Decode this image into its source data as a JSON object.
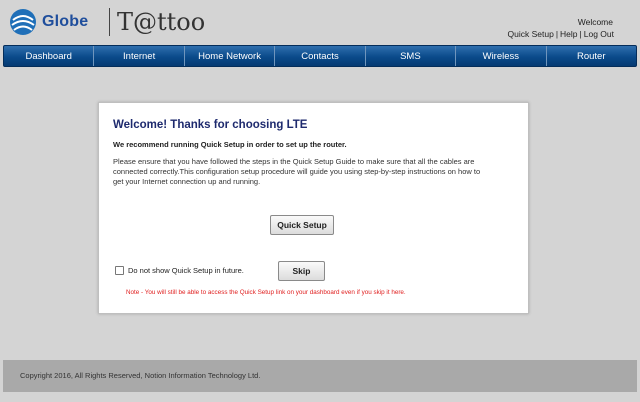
{
  "header": {
    "brand": "Globe",
    "product": "T@ttoo",
    "welcome": "Welcome",
    "links": [
      "Quick Setup",
      "Help",
      "Log Out"
    ],
    "link_separator": "|"
  },
  "nav": {
    "items": [
      "Dashboard",
      "Internet",
      "Home Network",
      "Contacts",
      "SMS",
      "Wireless",
      "Router"
    ]
  },
  "dialog": {
    "title": "Welcome! Thanks for choosing LTE",
    "subtitle": "We recommend running Quick Setup in order to set up the router.",
    "body": "Please ensure that you have followed the steps in the Quick Setup Guide to make sure that all the cables are connected correctly.This configuration setup procedure will guide you using step-by-step instructions on how to get your Internet connection up and running.",
    "quick_setup_button": "Quick Setup",
    "checkbox_label": "Do not show Quick Setup in future.",
    "checkbox_checked": false,
    "skip_button": "Skip",
    "note": "Note - You will still be able to access the Quick Setup link on your dashboard even if you skip it here."
  },
  "footer": {
    "copyright": "Copyright 2016, All Rights Reserved, Notion Information Technology Ltd."
  },
  "colors": {
    "nav_blue": "#0a4a8a",
    "title_blue": "#1e2a6e",
    "note_red": "#e02020",
    "background": "#d4d4d4",
    "footer": "#a9a9a9"
  }
}
